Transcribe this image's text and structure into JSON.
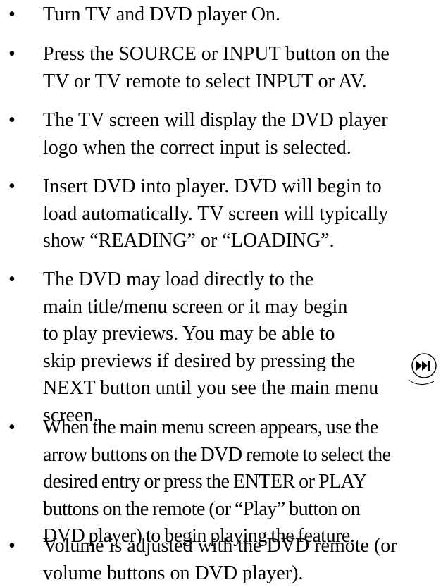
{
  "instructions": {
    "items": [
      {
        "bullet": "•",
        "lines": [
          "Turn TV and DVD player On."
        ]
      },
      {
        "bullet": "•",
        "lines": [
          "Press the SOURCE or INPUT button on the",
          "TV or TV remote to select INPUT or AV."
        ]
      },
      {
        "bullet": "•",
        "lines": [
          "The TV screen will display the DVD player",
          "logo when the correct input is selected."
        ]
      },
      {
        "bullet": "•",
        "lines": [
          "Insert DVD into player. DVD will begin to",
          "load automatically. TV screen will typically",
          "show “READING” or “LOADING”."
        ]
      },
      {
        "bullet": "•",
        "lines": [
          "The DVD may load directly to the",
          "main title/menu screen or it may begin",
          "to play previews. You may be able to",
          "skip previews if desired by pressing the",
          "NEXT button until you see the main menu",
          "screen."
        ]
      },
      {
        "bullet": "•",
        "lines": [
          "When the main menu screen appears, use the",
          "arrow buttons on the DVD remote to select the",
          "desired entry or press the ENTER or PLAY",
          "buttons on the remote (or “Play” button on",
          "DVD player) to begin playing the feature."
        ]
      },
      {
        "bullet": "•",
        "lines": [
          "Volume is adjusted with the DVD remote (or",
          "volume buttons on DVD player)."
        ]
      }
    ]
  },
  "icons": {
    "next_button_icon": "next-skip-icon",
    "icon_color": "#000000"
  }
}
